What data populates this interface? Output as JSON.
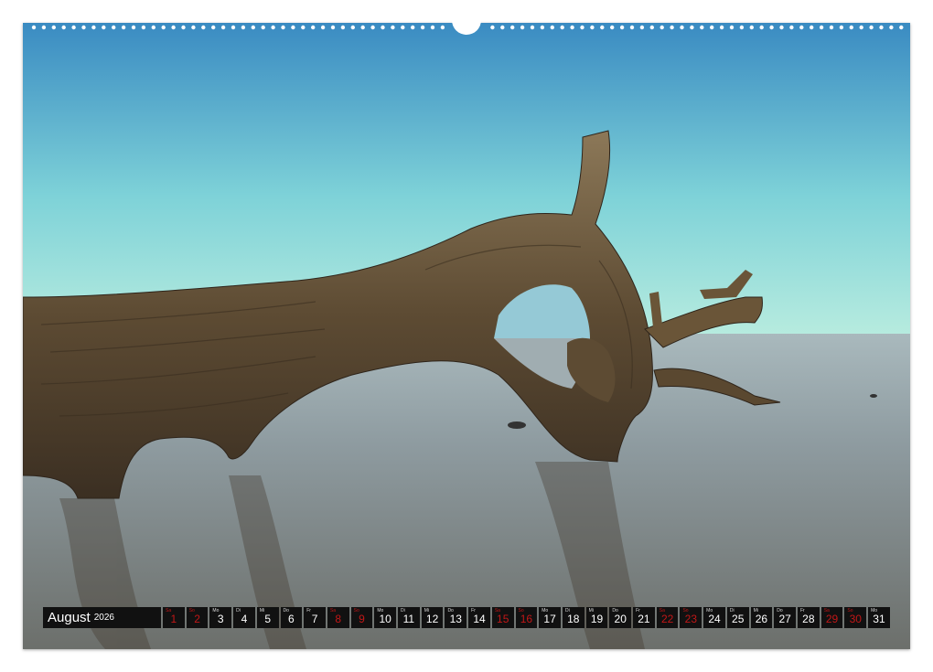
{
  "calendar": {
    "month": "August",
    "year": "2026",
    "days": [
      {
        "wd": "Sa",
        "num": "1",
        "weekend": true
      },
      {
        "wd": "So",
        "num": "2",
        "weekend": true
      },
      {
        "wd": "Mo",
        "num": "3",
        "weekend": false
      },
      {
        "wd": "Di",
        "num": "4",
        "weekend": false
      },
      {
        "wd": "Mi",
        "num": "5",
        "weekend": false
      },
      {
        "wd": "Do",
        "num": "6",
        "weekend": false
      },
      {
        "wd": "Fr",
        "num": "7",
        "weekend": false
      },
      {
        "wd": "Sa",
        "num": "8",
        "weekend": true
      },
      {
        "wd": "So",
        "num": "9",
        "weekend": true
      },
      {
        "wd": "Mo",
        "num": "10",
        "weekend": false
      },
      {
        "wd": "Di",
        "num": "11",
        "weekend": false
      },
      {
        "wd": "Mi",
        "num": "12",
        "weekend": false
      },
      {
        "wd": "Do",
        "num": "13",
        "weekend": false
      },
      {
        "wd": "Fr",
        "num": "14",
        "weekend": false
      },
      {
        "wd": "Sa",
        "num": "15",
        "weekend": true
      },
      {
        "wd": "So",
        "num": "16",
        "weekend": true
      },
      {
        "wd": "Mo",
        "num": "17",
        "weekend": false
      },
      {
        "wd": "Di",
        "num": "18",
        "weekend": false
      },
      {
        "wd": "Mi",
        "num": "19",
        "weekend": false
      },
      {
        "wd": "Do",
        "num": "20",
        "weekend": false
      },
      {
        "wd": "Fr",
        "num": "21",
        "weekend": false
      },
      {
        "wd": "Sa",
        "num": "22",
        "weekend": true
      },
      {
        "wd": "So",
        "num": "23",
        "weekend": true
      },
      {
        "wd": "Mo",
        "num": "24",
        "weekend": false
      },
      {
        "wd": "Di",
        "num": "25",
        "weekend": false
      },
      {
        "wd": "Mi",
        "num": "26",
        "weekend": false
      },
      {
        "wd": "Do",
        "num": "27",
        "weekend": false
      },
      {
        "wd": "Fr",
        "num": "28",
        "weekend": false
      },
      {
        "wd": "Sa",
        "num": "29",
        "weekend": true
      },
      {
        "wd": "So",
        "num": "30",
        "weekend": true
      },
      {
        "wd": "Mo",
        "num": "31",
        "weekend": false
      }
    ]
  },
  "colors": {
    "sky_top": "#3d8fc4",
    "sky_horizon": "#a6e8df",
    "water": "#8d9aa0",
    "wood": "#5e4a31",
    "weekend": "#c21717",
    "strip": "#111111"
  }
}
